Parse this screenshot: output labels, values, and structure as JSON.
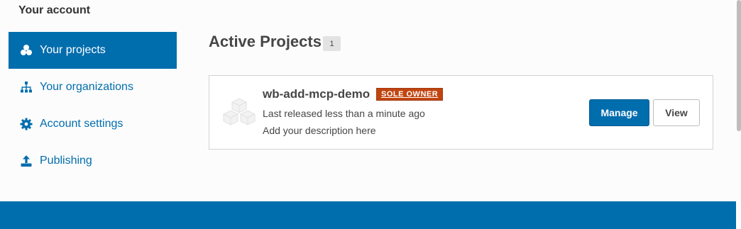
{
  "account": {
    "heading": "Your account"
  },
  "sidebar": {
    "items": [
      {
        "label": "Your projects",
        "icon": "cubes-icon",
        "active": true
      },
      {
        "label": "Your organizations",
        "icon": "sitemap-icon",
        "active": false
      },
      {
        "label": "Account settings",
        "icon": "gear-icon",
        "active": false
      },
      {
        "label": "Publishing",
        "icon": "upload-icon",
        "active": false
      }
    ]
  },
  "main": {
    "title": "Active Projects",
    "count": "1",
    "projects": [
      {
        "name": "wb-add-mcp-demo",
        "badge": "SOLE OWNER",
        "released": "Last released less than a minute ago",
        "description": "Add your description here",
        "manage_label": "Manage",
        "view_label": "View"
      }
    ]
  },
  "colors": {
    "accent": "#006dad",
    "badge": "#c1440e",
    "text": "#464646"
  }
}
